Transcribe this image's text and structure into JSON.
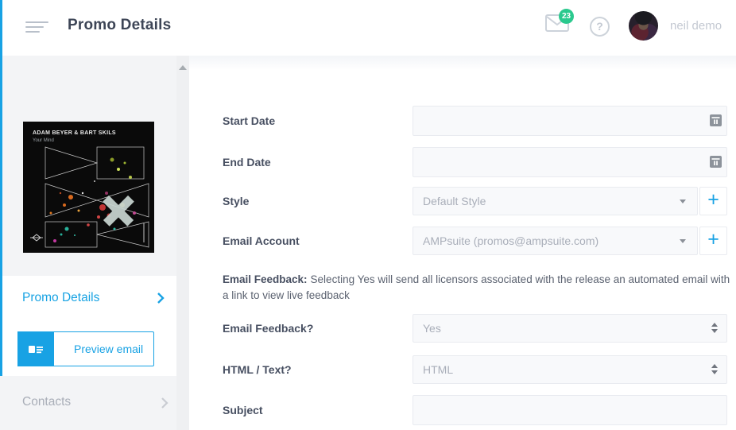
{
  "colors": {
    "accent_blue": "#18a2e4",
    "badge_green": "#2bc98e",
    "label_text": "#474f61",
    "muted_text": "#a9aeb9",
    "sidebar_bg": "#f3f4f6",
    "input_bg": "#f8f9fb",
    "input_border": "#e9ebf0"
  },
  "header": {
    "title": "Promo Details",
    "mail_badge": "23",
    "help_glyph": "?",
    "user_name": "neil demo"
  },
  "sidebar": {
    "album": {
      "artist": "ADAM BEYER & BART SKILS",
      "title": "Your Mind"
    },
    "nav": [
      {
        "label": "Promo Details",
        "active": true
      },
      {
        "label": "Contacts",
        "active": false
      }
    ],
    "preview_button_label": "Preview email"
  },
  "form": {
    "start_date": {
      "label": "Start Date",
      "value": ""
    },
    "end_date": {
      "label": "End Date",
      "value": ""
    },
    "style": {
      "label": "Style",
      "value": "Default Style",
      "add_glyph": "+"
    },
    "email_account": {
      "label": "Email Account",
      "value": "AMPsuite (promos@ampsuite.com)",
      "add_glyph": "+"
    },
    "feedback_note": {
      "bold": "Email Feedback:",
      "text": "Selecting Yes will send all licensors associated with the release an automated email with a link to view live feedback"
    },
    "email_feedback": {
      "label": "Email Feedback?",
      "value": "Yes"
    },
    "html_text": {
      "label": "HTML / Text?",
      "value": "HTML"
    },
    "subject": {
      "label": "Subject",
      "value": ""
    }
  }
}
